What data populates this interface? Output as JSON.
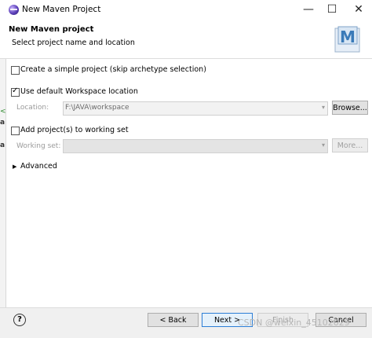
{
  "window": {
    "title": "New Maven Project",
    "min": "—",
    "max": "☐",
    "close": "✕"
  },
  "header": {
    "title": "New Maven project",
    "subtitle": "Select project name and location",
    "logo_letter": "M",
    "accent": "#3a7ab8"
  },
  "form": {
    "simple_project": {
      "label": "Create a simple project (skip archetype selection)",
      "checked": false
    },
    "default_location": {
      "label": "Use default Workspace location",
      "checked": true
    },
    "location": {
      "label": "Location:",
      "value": "F:\\JAVA\\workspace",
      "browse": "Browse..."
    },
    "working_set_check": {
      "label": "Add project(s) to working set",
      "checked": false
    },
    "working_set": {
      "label": "Working set:",
      "value": "",
      "more": "More..."
    },
    "advanced": {
      "label": "Advanced",
      "expanded": false
    }
  },
  "footer": {
    "help": "?",
    "back": "< Back",
    "next": "Next >",
    "finish": "Finish",
    "cancel": "Cancel",
    "watermark": "CSDN @weixin_45102029"
  },
  "side_glyphs": [
    "<",
    "a",
    "a"
  ]
}
